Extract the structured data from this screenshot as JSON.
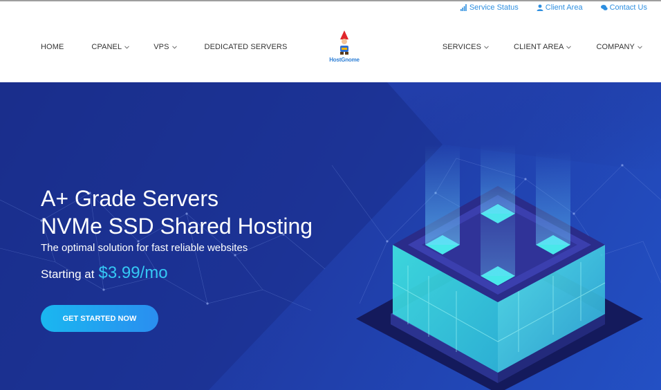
{
  "topbar": {
    "service_status": "Service Status",
    "client_area": "Client Area",
    "contact_us": "Contact Us"
  },
  "nav": {
    "left": [
      "HOME",
      "CPANEL",
      "VPS",
      "DEDICATED SERVERS"
    ],
    "right": [
      "SERVICES",
      "CLIENT AREA",
      "COMPANY"
    ]
  },
  "logo": {
    "text": "HostGnome"
  },
  "hero": {
    "title_line1": "A+ Grade Servers",
    "title_line2": "NVMe SSD Shared Hosting",
    "subtitle": "The optimal solution for fast reliable websites",
    "price_prefix": "Starting at",
    "price": "$3.99/mo",
    "cta": "GET STARTED NOW"
  },
  "colors": {
    "accent": "#2e8fe0",
    "hero_bg": "#1f3aa3",
    "price": "#35c8f5",
    "cta": "#1ab7f0"
  },
  "icons": {
    "service_status": "signal-bars-icon",
    "client_area": "user-icon",
    "contact_us": "chat-bubbles-icon",
    "dropdown": "chevron-down-icon"
  }
}
